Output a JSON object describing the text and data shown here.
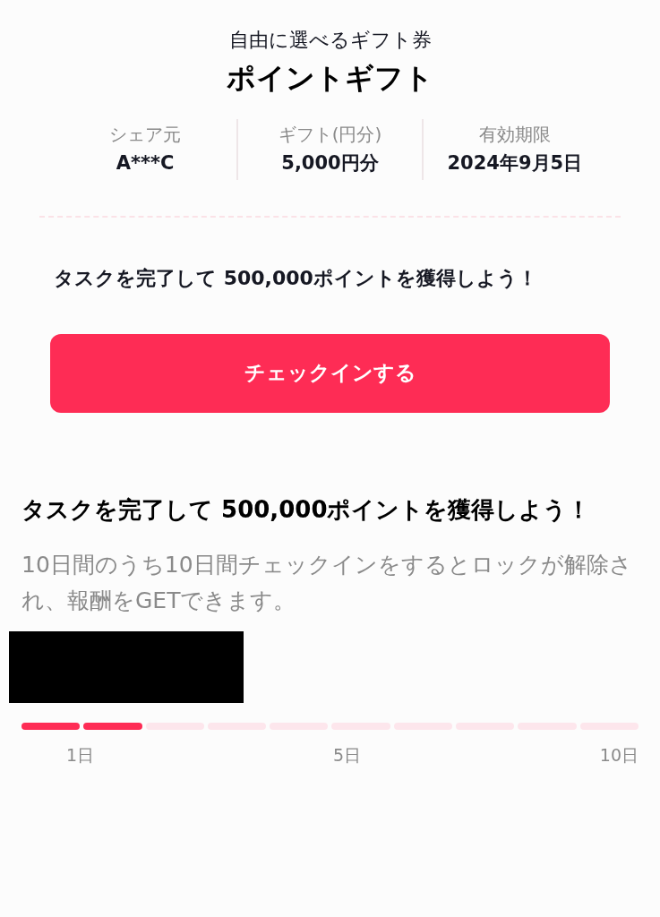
{
  "header": {
    "subtitle": "自由に選べるギフト券",
    "title": "ポイントギフト"
  },
  "info": [
    {
      "label": "シェア元",
      "value": "A***C"
    },
    {
      "label": "ギフト(円分)",
      "value": "5,000円分"
    },
    {
      "label": "有効期限",
      "value": "2024年9月5日"
    }
  ],
  "message": "タスクを完了して 500,000ポイントを獲得しよう！",
  "checkin_button": "チェックインする",
  "task": {
    "title": "タスクを完了して 500,000ポイントを獲得しよう！",
    "description": "10日間のうち10日間チェックインをするとロックが解除され、報酬をGETできます。"
  },
  "progress": {
    "segments": [
      {
        "filled": true
      },
      {
        "filled": true
      },
      {
        "filled": false
      },
      {
        "filled": false
      },
      {
        "filled": false
      },
      {
        "filled": false
      },
      {
        "filled": false
      },
      {
        "filled": false
      },
      {
        "filled": false
      },
      {
        "filled": false
      }
    ],
    "labels": [
      "1日",
      "5日",
      "10日"
    ]
  }
}
